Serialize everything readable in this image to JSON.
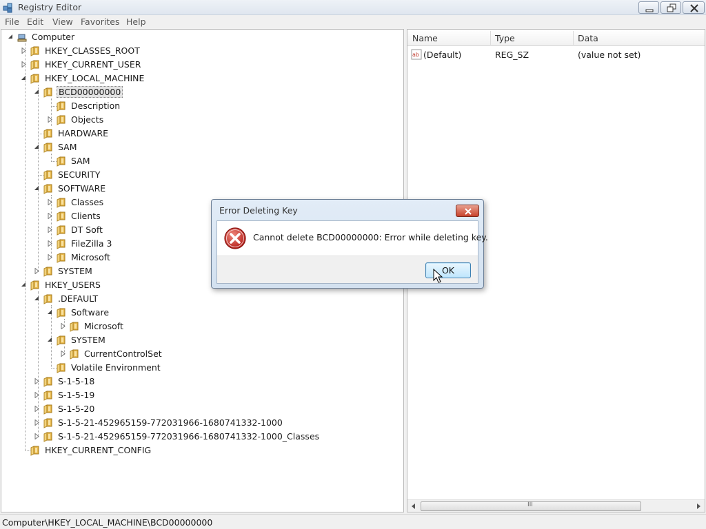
{
  "window": {
    "title": "Registry Editor"
  },
  "menu": [
    "File",
    "Edit",
    "View",
    "Favorites",
    "Help"
  ],
  "tree": {
    "root": "Computer",
    "nodes": [
      "HKEY_CLASSES_ROOT",
      "HKEY_CURRENT_USER",
      "HKEY_LOCAL_MACHINE",
      "BCD00000000",
      "Description",
      "Objects",
      "HARDWARE",
      "SAM",
      "SAM",
      "SECURITY",
      "SOFTWARE",
      "Classes",
      "Clients",
      "DT Soft",
      "FileZilla 3",
      "Microsoft",
      "SYSTEM",
      "HKEY_USERS",
      ".DEFAULT",
      "Software",
      "Microsoft",
      "SYSTEM",
      "CurrentControlSet",
      "Volatile Environment",
      "S-1-5-18",
      "S-1-5-19",
      "S-1-5-20",
      "S-1-5-21-452965159-772031966-1680741332-1000",
      "S-1-5-21-452965159-772031966-1680741332-1000_Classes",
      "HKEY_CURRENT_CONFIG"
    ],
    "selected": "BCD00000000"
  },
  "values": {
    "columns": [
      "Name",
      "Type",
      "Data"
    ],
    "rows": [
      {
        "name": "(Default)",
        "type": "REG_SZ",
        "data": "(value not set)",
        "icon": "string-value-icon"
      }
    ],
    "scroll_thumb_glyph": "III"
  },
  "status": {
    "path": "Computer\\HKEY_LOCAL_MACHINE\\BCD00000000"
  },
  "dialog": {
    "title": "Error Deleting Key",
    "message": "Cannot delete BCD00000000:  Error while deleting key.",
    "ok_label": "OK",
    "icon": "error-icon"
  },
  "colors": {
    "title_bar": "#dfe6ef",
    "dialog_frame": "#d3e1f0",
    "folder": "#e8b84a",
    "error_red": "#c9302c"
  }
}
